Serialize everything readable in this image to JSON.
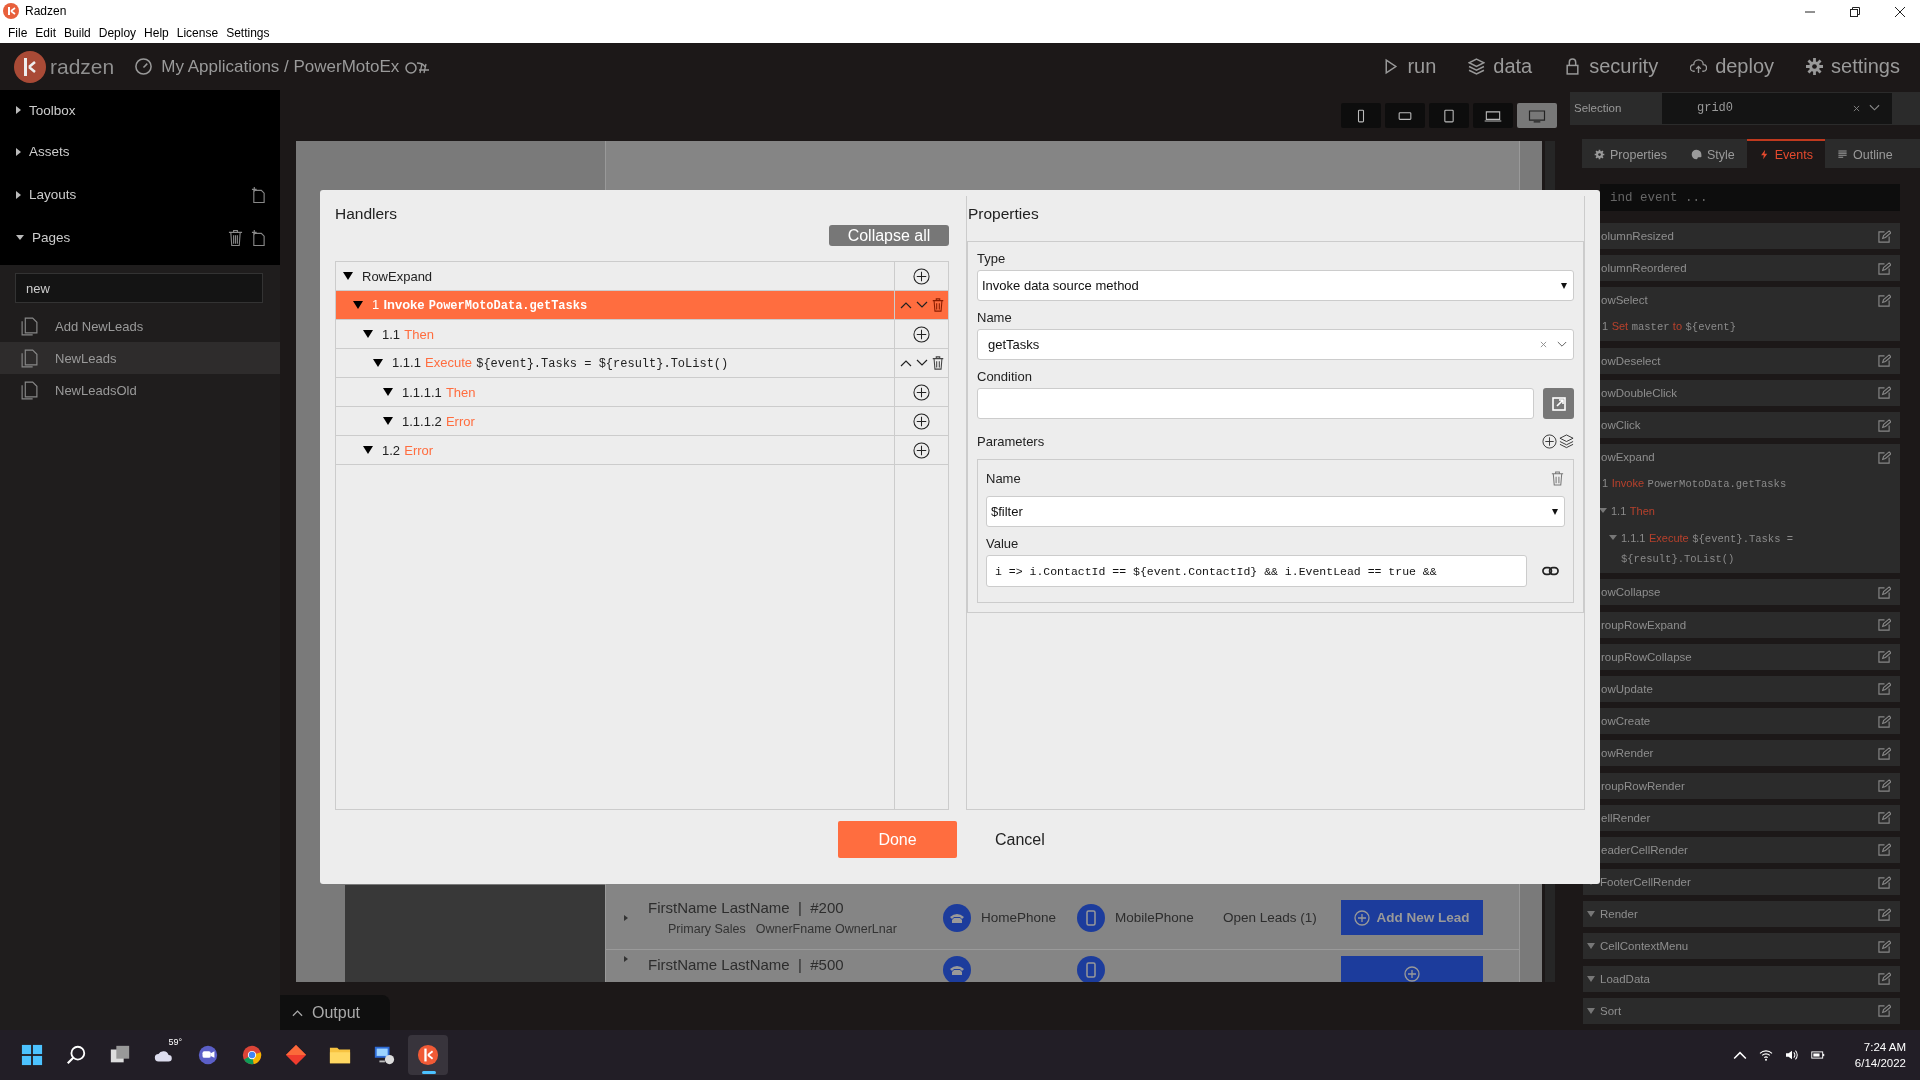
{
  "window": {
    "title": "Radzen"
  },
  "menu": [
    "File",
    "Edit",
    "Build",
    "Deploy",
    "Help",
    "License",
    "Settings"
  ],
  "header": {
    "brand": "radzen",
    "breadcrumb": "My Applications / PowerMotoEx",
    "nav": [
      {
        "label": "run",
        "kind": "run"
      },
      {
        "label": "data",
        "kind": "data"
      },
      {
        "label": "security",
        "kind": "security"
      },
      {
        "label": "deploy",
        "kind": "deploy"
      },
      {
        "label": "settings",
        "kind": "settings"
      }
    ]
  },
  "sidebar": {
    "sections": [
      {
        "label": "Toolbox",
        "kind": "plain",
        "expanded": false
      },
      {
        "label": "Assets",
        "kind": "plain",
        "expanded": false
      },
      {
        "label": "Layouts",
        "kind": "layouts",
        "expanded": false
      },
      {
        "label": "Pages",
        "kind": "pages",
        "expanded": true
      }
    ],
    "search": {
      "value": "new"
    },
    "pages": [
      {
        "label": "Add NewLeads",
        "selected": false
      },
      {
        "label": "NewLeads",
        "selected": true
      },
      {
        "label": "NewLeadsOld",
        "selected": false
      }
    ]
  },
  "devices": [
    {
      "kind": "phone",
      "selected": false
    },
    {
      "kind": "phone-landscape",
      "selected": false
    },
    {
      "kind": "tablet",
      "selected": false
    },
    {
      "kind": "laptop",
      "selected": false
    },
    {
      "kind": "desktop",
      "selected": true
    }
  ],
  "canvas": {
    "rows": [
      {
        "name": "FirstName LastName  |  #200",
        "sales_rep": "Primary Sales",
        "owner": "OwnerFname OwnerLnar",
        "home_phone": "HomePhone",
        "mobile_phone": "MobilePhone",
        "open_leads": "Open Leads (1)",
        "button": "Add New Lead"
      },
      {
        "name": "FirstName LastName  |  #500"
      }
    ]
  },
  "output": {
    "label": "Output"
  },
  "inspector": {
    "selection_label": "Selection",
    "selection": "grid0",
    "tabs": [
      {
        "label": "Properties",
        "kind": "properties",
        "selected": false
      },
      {
        "label": "Style",
        "kind": "style",
        "selected": false
      },
      {
        "label": "Events",
        "kind": "events",
        "selected": true
      },
      {
        "label": "Outline",
        "kind": "outline",
        "selected": false
      }
    ],
    "search": {
      "placeholder": "ind event ..."
    },
    "events": [
      {
        "name": "olumnResized"
      },
      {
        "name": "olumnReordered"
      },
      {
        "name": "owSelect",
        "handlers": [
          {
            "number": "1",
            "parts": [
              {
                "text": "Set",
                "kind": "keyword"
              },
              {
                "text": "master",
                "kind": "code"
              },
              {
                "text": "to",
                "kind": "keyword"
              },
              {
                "text": "${event}",
                "kind": "code"
              }
            ]
          }
        ]
      },
      {
        "name": "owDeselect"
      },
      {
        "name": "owDoubleClick"
      },
      {
        "name": "owClick"
      },
      {
        "name": "owExpand",
        "handlers": [
          {
            "number": "1",
            "parts": [
              {
                "text": "Invoke",
                "kind": "keyword"
              },
              {
                "text": "PowerMotoData.getTasks",
                "kind": "code"
              }
            ],
            "children": [
              {
                "number": "1.1",
                "parts": [
                  {
                    "text": "Then",
                    "kind": "keyword"
                  }
                ],
                "children": [
                  {
                    "number": "1.1.1",
                    "parts": [
                      {
                        "text": "Execute",
                        "kind": "keyword"
                      },
                      {
                        "text": "${event}.Tasks = ${result}.ToList()",
                        "kind": "code"
                      }
                    ]
                  }
                ]
              }
            ]
          }
        ]
      },
      {
        "name": "owCollapse"
      },
      {
        "name": "roupRowExpand"
      },
      {
        "name": "roupRowCollapse"
      },
      {
        "name": "owUpdate"
      },
      {
        "name": "owCreate"
      },
      {
        "name": "owRender"
      },
      {
        "name": "roupRowRender"
      },
      {
        "name": "ellRender"
      },
      {
        "name": "eaderCellRender"
      },
      {
        "name": "FooterCellRender",
        "caret": true
      },
      {
        "name": "Render",
        "caret": true
      },
      {
        "name": "CellContextMenu",
        "caret": true
      },
      {
        "name": "LoadData",
        "caret": true
      },
      {
        "name": "Sort",
        "caret": true
      }
    ]
  },
  "dialog": {
    "handlers_title": "Handlers",
    "collapse_button": "Collapse all",
    "tree": [
      {
        "kind": "event",
        "parts": [
          {
            "text": "RowExpand",
            "kind": "plain"
          }
        ],
        "expanded": true,
        "selected": false,
        "children": [
          {
            "kind": "action",
            "number": "1",
            "parts": [
              {
                "text": "Invoke",
                "kind": "keyword"
              },
              {
                "text": "PowerMotoData.getTasks",
                "kind": "code"
              }
            ],
            "expanded": true,
            "selected": true,
            "children": [
              {
                "kind": "branch",
                "number": "1.1",
                "parts": [
                  {
                    "text": "Then",
                    "kind": "keyword"
                  }
                ],
                "expanded": true,
                "selected": false,
                "children": [
                  {
                    "kind": "action",
                    "number": "1.1.1",
                    "parts": [
                      {
                        "text": "Execute",
                        "kind": "keyword"
                      },
                      {
                        "text": "${event}.Tasks = ${result}.ToList()",
                        "kind": "code"
                      }
                    ],
                    "expanded": true,
                    "selected": false,
                    "children": [
                      {
                        "kind": "branch",
                        "number": "1.1.1.1",
                        "parts": [
                          {
                            "text": "Then",
                            "kind": "keyword"
                          }
                        ],
                        "expanded": true,
                        "selected": false
                      },
                      {
                        "kind": "branch",
                        "number": "1.1.1.2",
                        "parts": [
                          {
                            "text": "Error",
                            "kind": "keyword"
                          }
                        ],
                        "expanded": true,
                        "selected": false
                      }
                    ]
                  }
                ]
              },
              {
                "kind": "branch",
                "number": "1.2",
                "parts": [
                  {
                    "text": "Error",
                    "kind": "keyword"
                  }
                ],
                "expanded": true,
                "selected": false
              }
            ]
          }
        ]
      }
    ],
    "properties_title": "Properties",
    "type_label": "Type",
    "type_value": "Invoke data source method",
    "name_label": "Name",
    "name_value": "getTasks",
    "condition_label": "Condition",
    "parameters_label": "Parameters",
    "parameters": [
      {
        "name_label": "Name",
        "name_value": "$filter",
        "value_label": "Value",
        "value": "i => i.ContactId == ${event.ContactId} && i.EventLead == true &&"
      }
    ],
    "done": "Done",
    "cancel": "Cancel"
  },
  "taskbar": {
    "apps": [
      {
        "kind": "start",
        "selected": false
      },
      {
        "kind": "search",
        "selected": false
      },
      {
        "kind": "taskview",
        "selected": false
      },
      {
        "kind": "weather",
        "label": "59°",
        "selected": false
      },
      {
        "kind": "chat",
        "selected": false
      },
      {
        "kind": "browser",
        "selected": false
      },
      {
        "kind": "diamond",
        "selected": false
      },
      {
        "kind": "folder",
        "selected": false
      },
      {
        "kind": "remote",
        "selected": false
      },
      {
        "kind": "radzen",
        "selected": true
      }
    ],
    "time": "7:24 AM",
    "date": "6/14/2022"
  }
}
